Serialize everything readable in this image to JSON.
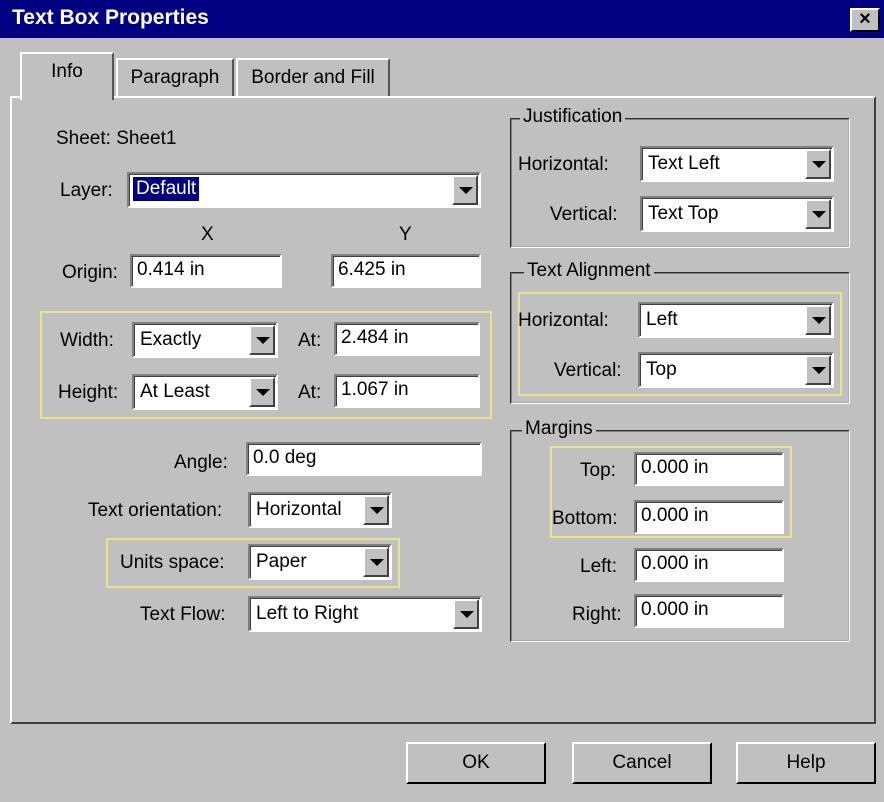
{
  "window": {
    "title": "Text Box Properties",
    "close": "×"
  },
  "tabs": [
    "Info",
    "Paragraph",
    "Border and Fill"
  ],
  "info": {
    "sheet_label": "Sheet: Sheet1",
    "layer": {
      "label": "Layer:",
      "value": "Default"
    },
    "x_header": "X",
    "y_header": "Y",
    "origin": {
      "label": "Origin:",
      "x": "0.414 in",
      "y": "6.425 in"
    },
    "width": {
      "label": "Width:",
      "mode": "Exactly",
      "at_label": "At:",
      "value": "2.484 in"
    },
    "height": {
      "label": "Height:",
      "mode": "At Least",
      "at_label": "At:",
      "value": "1.067 in"
    },
    "angle": {
      "label": "Angle:",
      "value": "0.0 deg"
    },
    "text_orientation": {
      "label": "Text orientation:",
      "value": "Horizontal"
    },
    "units_space": {
      "label": "Units space:",
      "value": "Paper"
    },
    "text_flow": {
      "label": "Text Flow:",
      "value": "Left to Right"
    }
  },
  "justification": {
    "title": "Justification",
    "horizontal": {
      "label": "Horizontal:",
      "value": "Text Left"
    },
    "vertical": {
      "label": "Vertical:",
      "value": "Text Top"
    }
  },
  "text_alignment": {
    "title": "Text Alignment",
    "horizontal": {
      "label": "Horizontal:",
      "value": "Left"
    },
    "vertical": {
      "label": "Vertical:",
      "value": "Top"
    }
  },
  "margins": {
    "title": "Margins",
    "top": {
      "label": "Top:",
      "value": "0.000 in"
    },
    "bottom": {
      "label": "Bottom:",
      "value": "0.000 in"
    },
    "left": {
      "label": "Left:",
      "value": "0.000 in"
    },
    "right": {
      "label": "Right:",
      "value": "0.000 in"
    }
  },
  "buttons": {
    "ok": "OK",
    "cancel": "Cancel",
    "help": "Help"
  }
}
